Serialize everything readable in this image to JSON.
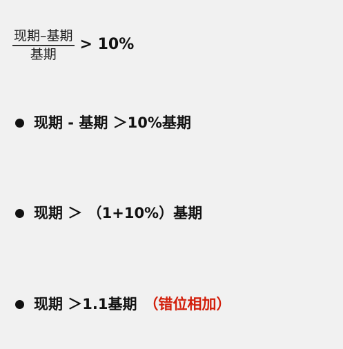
{
  "fraction": {
    "numerator": "现期–基期",
    "denominator": "基期",
    "rhs": "> 10%"
  },
  "bullets": [
    {
      "text": "现期 - 基期 ＞10%基期"
    },
    {
      "text": "现期 ＞ （1+10%）基期"
    },
    {
      "text": "现期 ＞1.1基期",
      "note": "（错位相加）"
    }
  ],
  "colors": {
    "background": "#f1f1f1",
    "text": "#111111",
    "note": "#d21e0a"
  }
}
